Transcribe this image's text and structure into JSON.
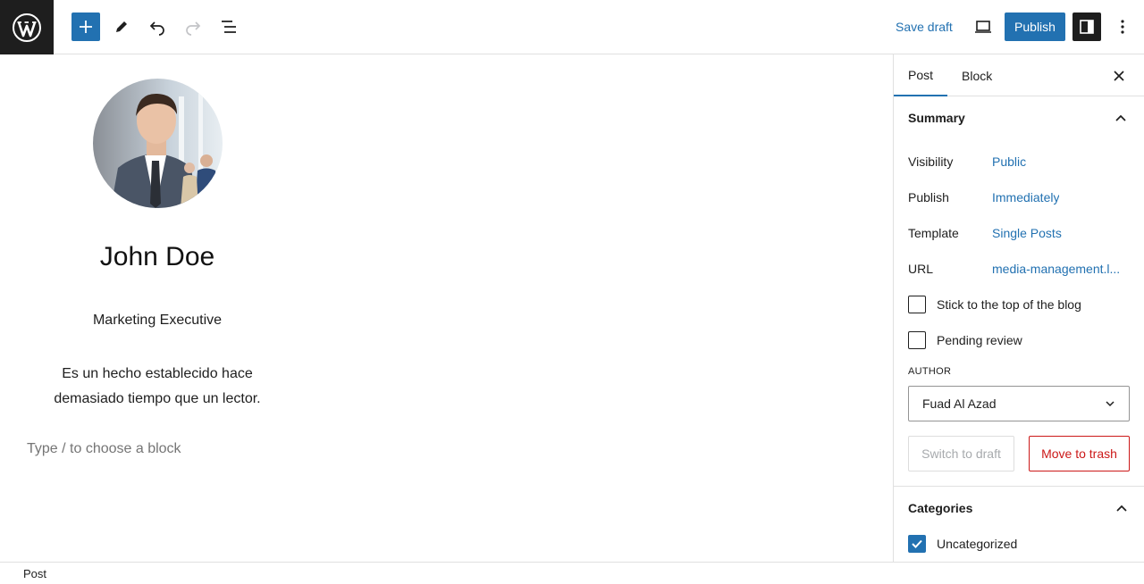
{
  "toolbar": {
    "save_draft": "Save draft",
    "publish": "Publish",
    "accent_color": "#2271b1"
  },
  "post": {
    "name": "John Doe",
    "role": "Marketing Executive",
    "bio": "Es un hecho establecido hace demasiado tiempo que un lector.",
    "placeholder": "Type / to choose a block"
  },
  "sidebar": {
    "tabs": [
      {
        "label": "Post",
        "active": true
      },
      {
        "label": "Block",
        "active": false
      }
    ],
    "summary": {
      "title": "Summary",
      "rows": [
        {
          "label": "Visibility",
          "value": "Public"
        },
        {
          "label": "Publish",
          "value": "Immediately"
        },
        {
          "label": "Template",
          "value": "Single Posts"
        },
        {
          "label": "URL",
          "value": "media-management.l..."
        }
      ],
      "checks": [
        {
          "label": "Stick to the top of the blog",
          "checked": false
        },
        {
          "label": "Pending review",
          "checked": false
        }
      ],
      "author_label": "AUTHOR",
      "author_value": "Fuad Al Azad",
      "switch_draft": "Switch to draft",
      "move_trash": "Move to trash"
    },
    "categories": {
      "title": "Categories",
      "items": [
        {
          "label": "Uncategorized",
          "checked": true
        }
      ]
    }
  },
  "footer": {
    "breadcrumb": "Post"
  }
}
